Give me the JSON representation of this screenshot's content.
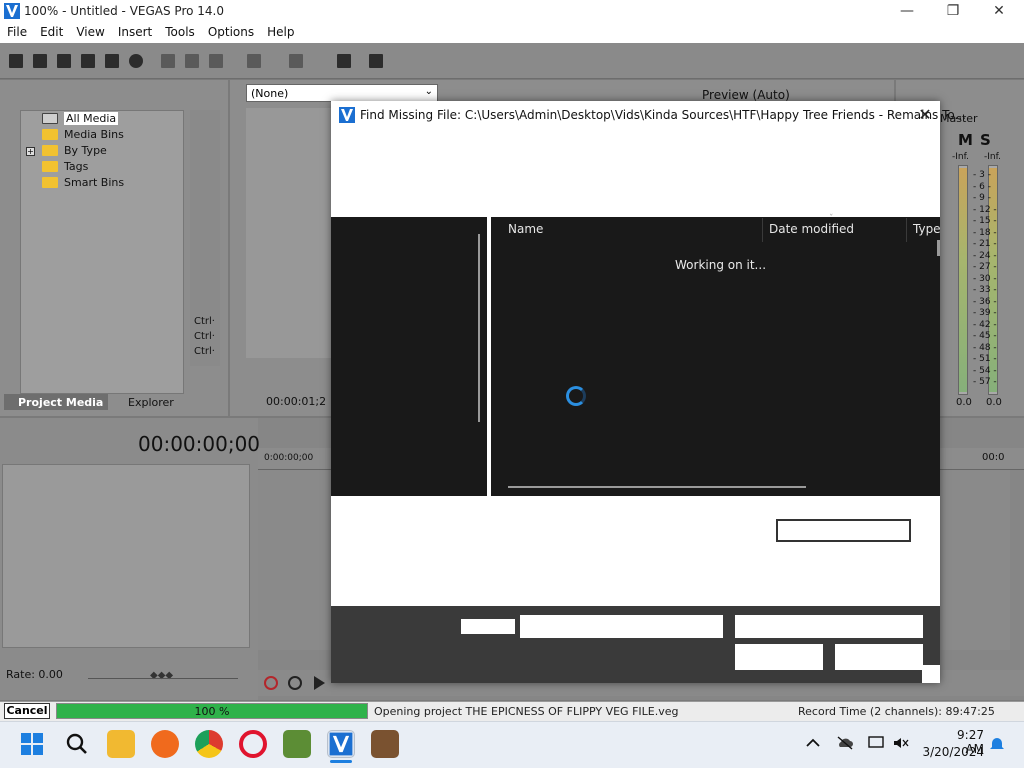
{
  "window": {
    "title": "100% - Untitled - VEGAS Pro 14.0",
    "minimize": "—",
    "maximize": "❐",
    "close": "✕"
  },
  "menu": [
    "File",
    "Edit",
    "View",
    "Insert",
    "Tools",
    "Options",
    "Help"
  ],
  "media_panel": {
    "tree": [
      {
        "label": "All Media",
        "selected": true
      },
      {
        "label": "Media Bins"
      },
      {
        "label": "By Type",
        "expandable": true
      },
      {
        "label": "Tags"
      },
      {
        "label": "Smart Bins"
      }
    ],
    "expand_glyph": "+",
    "tabs": {
      "project_media": "Project Media",
      "explorer": "Explorer"
    },
    "ctrl_labels": [
      "Ctrl·",
      "Ctrl·",
      "Ctrl·"
    ]
  },
  "preview": {
    "dropdown_value": "(None)",
    "mode": "Preview (Auto)",
    "timecode_small": "00:00:01;2"
  },
  "mixer": {
    "label": "Master",
    "ms": [
      "M",
      "S"
    ],
    "peak_labels": [
      "-Inf.",
      "-Inf."
    ],
    "scale": [
      "3",
      "6",
      "9",
      "12",
      "15",
      "18",
      "21",
      "24",
      "27",
      "30",
      "33",
      "36",
      "39",
      "42",
      "45",
      "48",
      "51",
      "54",
      "57"
    ],
    "readouts": [
      "0.0",
      "0.0"
    ]
  },
  "timeline": {
    "timecode": "00:00:00;00",
    "ruler_start": "0:00:00;00",
    "ruler_end": "00:0",
    "rate": "Rate: 0.00"
  },
  "status": {
    "cancel": "Cancel",
    "progress_percent": 100,
    "progress_text": "100 %",
    "message": "Opening project THE EPICNESS OF FLIPPY VEG FILE.veg",
    "record_time": "Record Time (2 channels): 89:47:25"
  },
  "dialog": {
    "title": "Find Missing File: C:\\Users\\Admin\\Desktop\\Vids\\Kinda Sources\\HTF\\Happy Tree Friends - Remains To...",
    "columns": [
      "Name",
      "Date modified",
      "Type"
    ],
    "loading_text": "Working on it...",
    "close": "✕"
  },
  "taskbar": {
    "time": "9:27 AM",
    "date": "3/20/2024"
  },
  "colors": {
    "accent_blue": "#2b8fe0",
    "progress_green": "#2fb24a"
  }
}
